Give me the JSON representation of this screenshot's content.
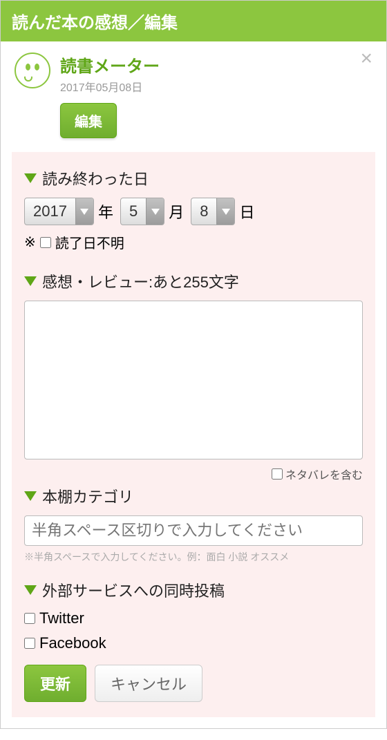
{
  "header": {
    "title": "読んだ本の感想／編集"
  },
  "user": {
    "name": "読書メーター",
    "date": "2017年05月08日",
    "edit_label": "編集"
  },
  "close": "×",
  "sections": {
    "finished_date": {
      "title": "読み終わった日",
      "year": "2017",
      "year_suffix": "年",
      "month": "5",
      "month_suffix": "月",
      "day": "8",
      "day_suffix": "日",
      "unknown_prefix": "※",
      "unknown_label": "読了日不明"
    },
    "review": {
      "title": "感想・レビュー:あと255文字",
      "spoiler_label": "ネタバレを含む"
    },
    "shelf": {
      "title": "本棚カテゴリ",
      "placeholder": "半角スペース区切りで入力してください",
      "hint": "※半角スペースで入力してください。例：面白 小説 オススメ"
    },
    "external": {
      "title": "外部サービスへの同時投稿",
      "twitter": "Twitter",
      "facebook": "Facebook"
    }
  },
  "buttons": {
    "update": "更新",
    "cancel": "キャンセル"
  }
}
